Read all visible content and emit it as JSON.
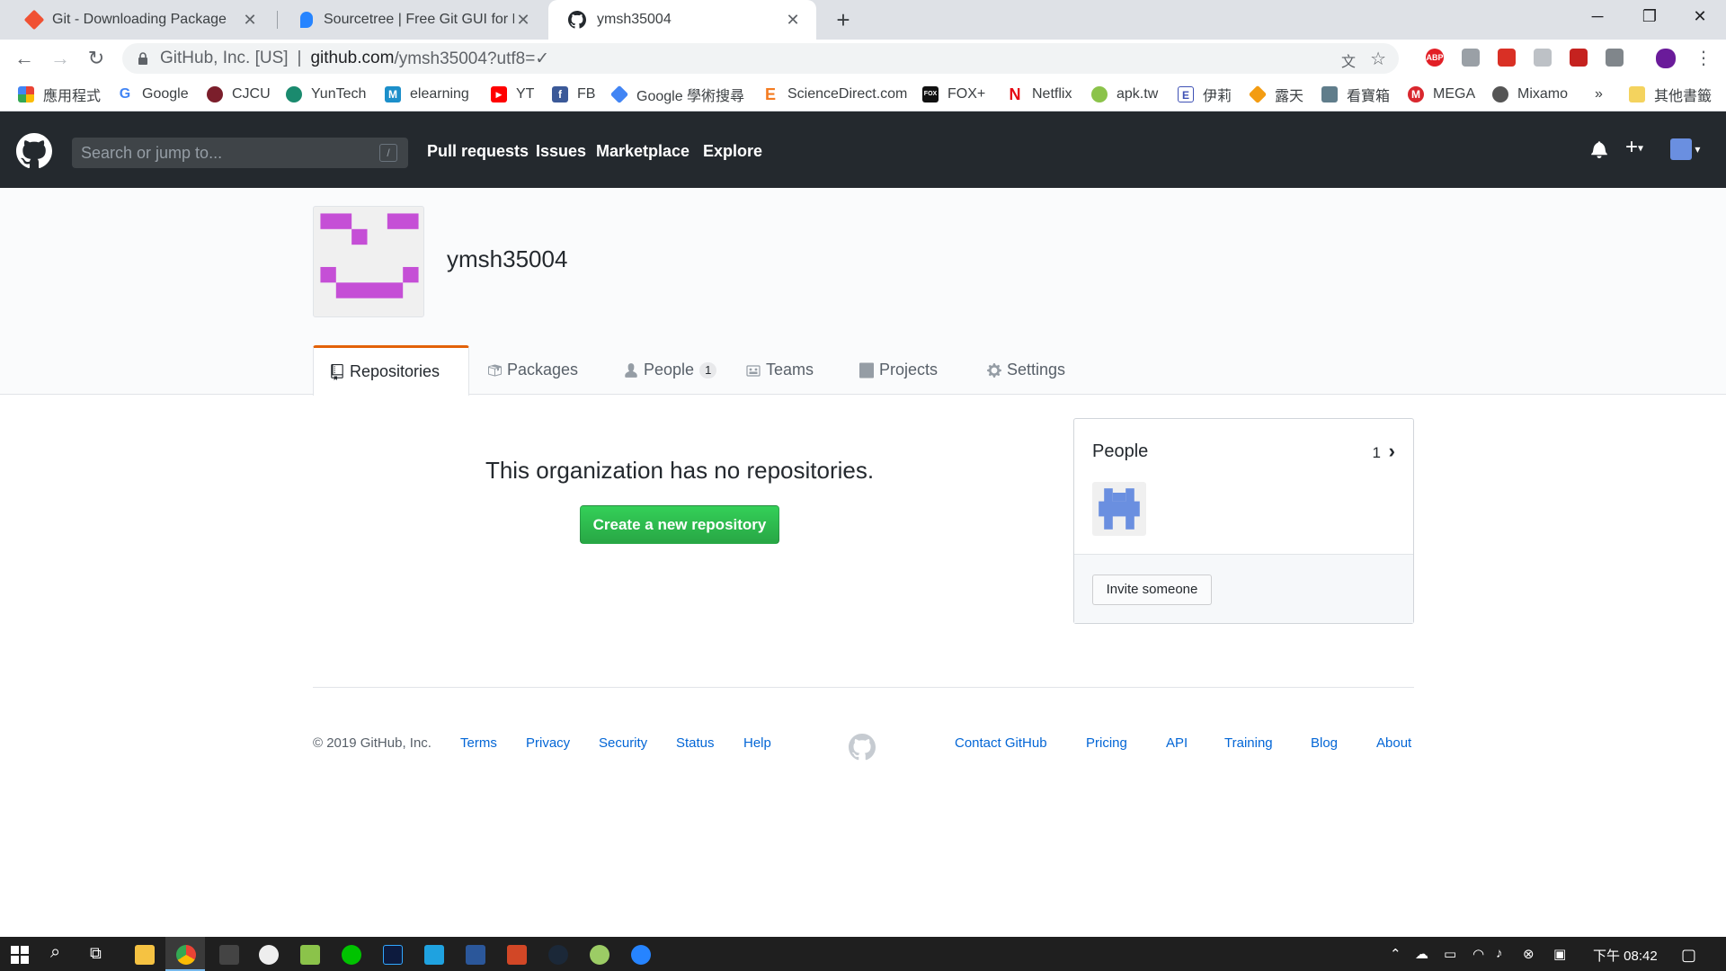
{
  "browser": {
    "tabs": [
      {
        "title": "Git - Downloading Package",
        "icon": "git-icon",
        "active": false
      },
      {
        "title": "Sourcetree | Free Git GUI for Mac",
        "icon": "sourcetree-icon",
        "active": false
      },
      {
        "title": "ymsh35004",
        "icon": "github-icon",
        "active": true
      }
    ],
    "new_tab": "+",
    "window_controls": {
      "minimize": "─",
      "maximize": "❐",
      "close": "✕"
    },
    "nav": {
      "back": "←",
      "forward": "→",
      "reload": "↻"
    },
    "omnibox": {
      "site": "GitHub, Inc. [US]",
      "separator": "|",
      "url_host": "github.com",
      "url_path": "/ymsh35004?utf8=✓"
    },
    "bookmarks": [
      {
        "label": "應用程式",
        "icon": "apps-grid-icon",
        "color": "#ea4335"
      },
      {
        "label": "Google",
        "icon": "google-icon",
        "color": "#4285f4"
      },
      {
        "label": "CJCU",
        "icon": "cjcu-icon",
        "color": "#7b1e2b"
      },
      {
        "label": "YunTech",
        "icon": "yuntech-icon",
        "color": "#1a8a6e"
      },
      {
        "label": "elearning",
        "icon": "moodle-icon",
        "color": "#1c8fca"
      },
      {
        "label": "YT",
        "icon": "youtube-icon",
        "color": "#ff0000"
      },
      {
        "label": "FB",
        "icon": "facebook-icon",
        "color": "#3b5998"
      },
      {
        "label": "Google 學術搜尋",
        "icon": "scholar-icon",
        "color": "#4285f4"
      },
      {
        "label": "ScienceDirect.com",
        "icon": "elsevier-icon",
        "color": "#f47b20"
      },
      {
        "label": "FOX+",
        "icon": "fox-icon",
        "color": "#111111"
      },
      {
        "label": "Netflix",
        "icon": "netflix-icon",
        "color": "#e50914"
      },
      {
        "label": "apk.tw",
        "icon": "apk-icon",
        "color": "#8bc34a"
      },
      {
        "label": "伊莉",
        "icon": "eyny-icon",
        "color": "#3f51b5"
      },
      {
        "label": "露天",
        "icon": "ruten-icon",
        "color": "#f39c12"
      },
      {
        "label": "看寶箱",
        "icon": "box-icon",
        "color": "#607d8b"
      },
      {
        "label": "MEGA",
        "icon": "mega-icon",
        "color": "#d9272e"
      },
      {
        "label": "Mixamo",
        "icon": "mixamo-icon",
        "color": "#555555"
      }
    ],
    "bookmarks_more": "»",
    "other_bookmarks": "其他書籤"
  },
  "github": {
    "search_placeholder": "Search or jump to...",
    "search_shortcut": "/",
    "nav": [
      "Pull requests",
      "Issues",
      "Marketplace",
      "Explore"
    ],
    "org_name": "ymsh35004",
    "tabs": [
      {
        "label": "Repositories",
        "icon": "repo-icon"
      },
      {
        "label": "Packages",
        "icon": "package-icon"
      },
      {
        "label": "People",
        "icon": "person-icon",
        "count": "1"
      },
      {
        "label": "Teams",
        "icon": "team-icon"
      },
      {
        "label": "Projects",
        "icon": "project-icon"
      },
      {
        "label": "Settings",
        "icon": "gear-icon"
      }
    ],
    "blankslate_title": "This organization has no repositories.",
    "create_button": "Create a new repository",
    "people_box": {
      "title": "People",
      "count": "1",
      "chevron": "›",
      "invite_button": "Invite someone"
    },
    "footer": {
      "copyright": "© 2019 GitHub, Inc.",
      "left_links": [
        "Terms",
        "Privacy",
        "Security",
        "Status",
        "Help"
      ],
      "right_links": [
        "Contact GitHub",
        "Pricing",
        "API",
        "Training",
        "Blog",
        "About"
      ]
    },
    "colors": {
      "header_bg": "#24292e",
      "accent_tab": "#e36209",
      "create_green": "#28a745",
      "link_blue": "#0366d6",
      "avatar_org": "#c54fd6",
      "avatar_user": "#6a8fe0"
    }
  },
  "taskbar": {
    "clock": "下午 08:42",
    "apps": [
      "windows-start-icon",
      "search-icon",
      "task-view-icon",
      "file-explorer-icon",
      "chrome-icon",
      "media-icon",
      "unreal-icon",
      "notepad-icon",
      "line-icon",
      "photoshop-icon",
      "krita-icon",
      "word-icon",
      "powerpoint-icon",
      "steam-icon",
      "app-icon",
      "sourcetree-icon"
    ]
  }
}
